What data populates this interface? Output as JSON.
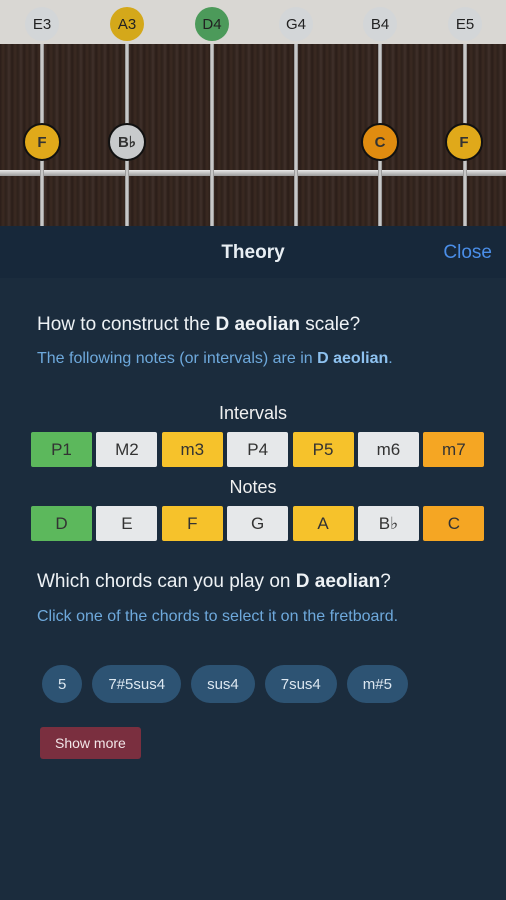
{
  "fretboard": {
    "open_notes": [
      {
        "label": "E3",
        "color": "#d3d6d8"
      },
      {
        "label": "A3",
        "color": "#d4a81a"
      },
      {
        "label": "D4",
        "color": "#4c9a5a"
      },
      {
        "label": "G4",
        "color": "#d3d6d8"
      },
      {
        "label": "B4",
        "color": "#d3d6d8"
      },
      {
        "label": "E5",
        "color": "#d3d6d8"
      }
    ],
    "fret_notes": [
      {
        "label": "F",
        "color": "#e0a91a"
      },
      {
        "label": "B♭",
        "color": "#c8cacc"
      },
      {
        "label": "C",
        "color": "#e08c10"
      },
      {
        "label": "F",
        "color": "#e0a91a"
      }
    ]
  },
  "panel": {
    "title": "Theory",
    "close_label": "Close"
  },
  "construct": {
    "q_prefix": "How to construct the ",
    "q_bold": "D aeolian",
    "q_suffix": " scale?",
    "sub_prefix": "The following notes (or intervals) are in ",
    "sub_bold": "D aeolian",
    "sub_suffix": "."
  },
  "intervals": {
    "label": "Intervals",
    "items": [
      {
        "text": "P1",
        "color": "#5cb85c"
      },
      {
        "text": "M2",
        "color": "#e6e8ea"
      },
      {
        "text": "m3",
        "color": "#f6c22b"
      },
      {
        "text": "P4",
        "color": "#e6e8ea"
      },
      {
        "text": "P5",
        "color": "#f6c22b"
      },
      {
        "text": "m6",
        "color": "#e6e8ea"
      },
      {
        "text": "m7",
        "color": "#f5a623"
      }
    ]
  },
  "notes": {
    "label": "Notes",
    "items": [
      {
        "text": "D",
        "color": "#5cb85c"
      },
      {
        "text": "E",
        "color": "#e6e8ea"
      },
      {
        "text": "F",
        "color": "#f6c22b"
      },
      {
        "text": "G",
        "color": "#e6e8ea"
      },
      {
        "text": "A",
        "color": "#f6c22b"
      },
      {
        "text": "B♭",
        "color": "#e6e8ea"
      },
      {
        "text": "C",
        "color": "#f5a623"
      }
    ]
  },
  "chords": {
    "q_prefix": "Which chords can you play on ",
    "q_bold": "D aeolian",
    "q_suffix": "?",
    "hint": "Click one of the chords to select it on the fretboard.",
    "items": [
      "5",
      "7#5sus4",
      "sus4",
      "7sus4",
      "m#5"
    ],
    "show_more": "Show more"
  }
}
